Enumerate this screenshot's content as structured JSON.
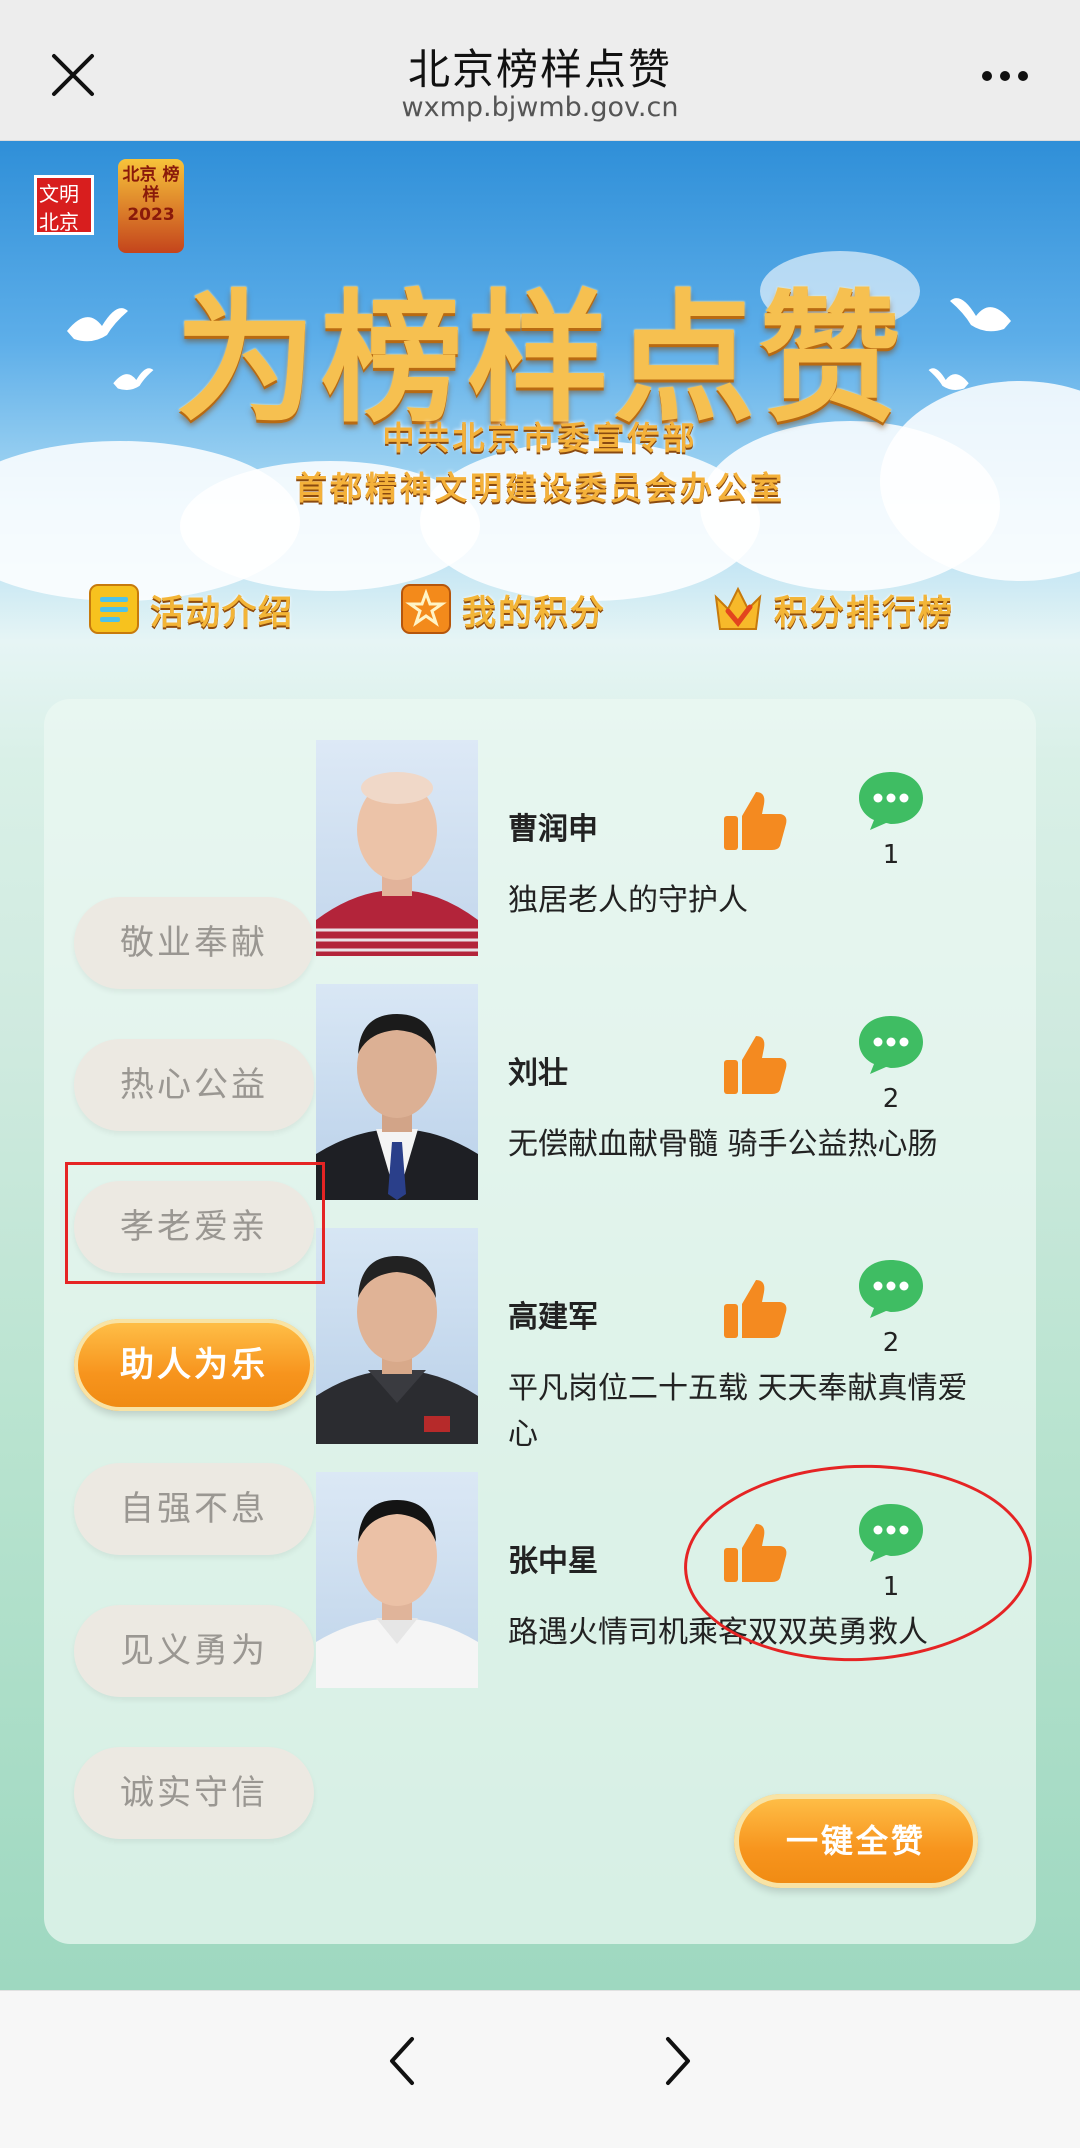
{
  "header": {
    "title": "北京榜样点赞",
    "url": "wxmp.bjwmb.gov.cn"
  },
  "banner": {
    "logo_text": "文明北京",
    "badge_text": "北京 榜样 2023",
    "title": "为榜样点赞",
    "sub1": "中共北京市委宣传部",
    "sub2": "首都精神文明建设委员会办公室"
  },
  "tabs": [
    {
      "label": "活动介绍",
      "icon": "document-icon"
    },
    {
      "label": "我的积分",
      "icon": "star-icon"
    },
    {
      "label": "积分排行榜",
      "icon": "crown-icon"
    }
  ],
  "categories": [
    {
      "label": "敬业奉献",
      "active": false
    },
    {
      "label": "热心公益",
      "active": false
    },
    {
      "label": "孝老爱亲",
      "active": false
    },
    {
      "label": "助人为乐",
      "active": true
    },
    {
      "label": "自强不息",
      "active": false
    },
    {
      "label": "见义勇为",
      "active": false
    },
    {
      "label": "诚实守信",
      "active": false
    }
  ],
  "people": [
    {
      "name": "曹润申",
      "desc": "独居老人的守护人",
      "comments": "1"
    },
    {
      "name": "刘壮",
      "desc": "无偿献血献骨髓 骑手公益热心肠",
      "comments": "2"
    },
    {
      "name": "高建军",
      "desc": "平凡岗位二十五载 天天奉献真情爱心",
      "comments": "2"
    },
    {
      "name": "张中星",
      "desc": "路遇火情司机乘客双双英勇救人",
      "comments": "1"
    }
  ],
  "like_all_label": "一键全赞",
  "colors": {
    "accent_orange": "#f7941d",
    "comment_green": "#3fbd63",
    "annotation_red": "#e52424",
    "banner_gold": "#f6c050"
  }
}
